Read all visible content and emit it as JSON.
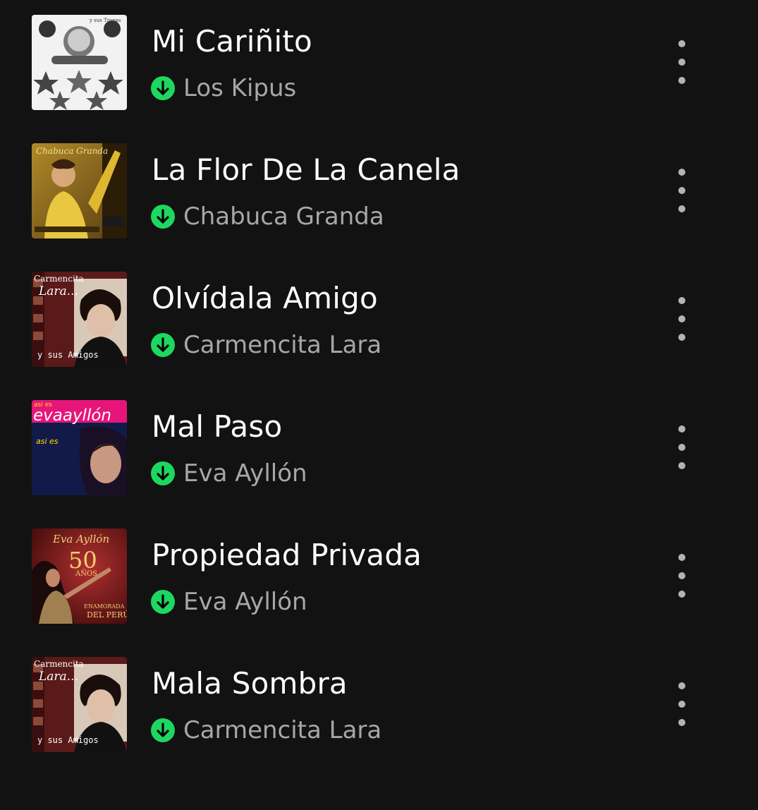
{
  "tracks": [
    {
      "title": "Mi Cariñito",
      "artist": "Los Kipus",
      "downloaded": true,
      "more_icon": "more-vertical-icon",
      "cover_icon": "album-cover-los-kipus"
    },
    {
      "title": "La Flor De La Canela",
      "artist": "Chabuca Granda",
      "downloaded": true,
      "more_icon": "more-vertical-icon",
      "cover_icon": "album-cover-chabuca-granda"
    },
    {
      "title": "Olvídala Amigo",
      "artist": "Carmencita Lara",
      "downloaded": true,
      "more_icon": "more-vertical-icon",
      "cover_icon": "album-cover-carmencita-lara"
    },
    {
      "title": "Mal Paso",
      "artist": "Eva Ayllón",
      "downloaded": true,
      "more_icon": "more-vertical-icon",
      "cover_icon": "album-cover-eva-aylllon-asi-es"
    },
    {
      "title": "Propiedad Privada",
      "artist": "Eva Ayllón",
      "downloaded": true,
      "more_icon": "more-vertical-icon",
      "cover_icon": "album-cover-eva-ayllon-50-anos"
    },
    {
      "title": "Mala Sombra",
      "artist": "Carmencita Lara",
      "downloaded": true,
      "more_icon": "more-vertical-icon",
      "cover_icon": "album-cover-carmencita-lara"
    }
  ],
  "colors": {
    "background": "#121212",
    "title": "#ffffff",
    "artist": "#a7a7a7",
    "download_badge": "#1ed760",
    "more_dots": "#b3b3b3"
  },
  "covers": {
    "kipus": {
      "top_text": "y sus Tropas"
    },
    "chabuca": {
      "name": "Chabuca Granda"
    },
    "carmencita": {
      "name_line1": "Carmencita",
      "name_line2": "Lara...",
      "bottom": "y sus Amigos"
    },
    "eva_asi": {
      "brand": "asi es",
      "name": "evaayllón",
      "inner": "asi es"
    },
    "eva_50": {
      "name": "Eva Ayllón",
      "number": "50",
      "unit": "AÑOS",
      "tag1": "ENAMORADA",
      "tag2": "DEL PERÚ"
    }
  }
}
